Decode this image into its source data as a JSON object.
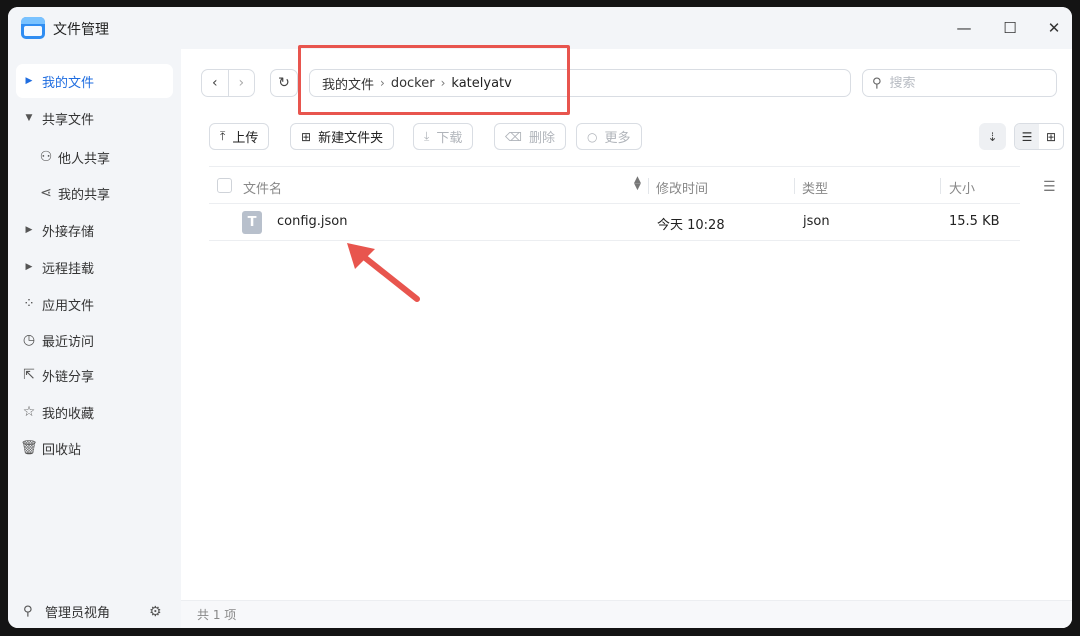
{
  "window": {
    "title": "文件管理",
    "controls": {
      "minimize": "—",
      "maximize": "☐",
      "close": "✕"
    }
  },
  "sidebar": {
    "items": [
      {
        "label": "我的文件",
        "icon": "chevron-right-icon",
        "glyph": "▶",
        "active": true
      },
      {
        "label": "共享文件",
        "icon": "chevron-down-icon",
        "glyph": "▼",
        "expanded": true
      },
      {
        "label": "他人共享",
        "icon": "users-icon",
        "glyph": "⚇"
      },
      {
        "label": "我的共享",
        "icon": "share-icon",
        "glyph": "⋖"
      },
      {
        "label": "外接存储",
        "icon": "chevron-right-icon",
        "glyph": "▶"
      },
      {
        "label": "远程挂载",
        "icon": "chevron-right-icon",
        "glyph": "▶"
      },
      {
        "label": "应用文件",
        "icon": "apps-icon",
        "glyph": "⁘"
      },
      {
        "label": "最近访问",
        "icon": "clock-icon",
        "glyph": "◷"
      },
      {
        "label": "外链分享",
        "icon": "external-link-icon",
        "glyph": "⇱"
      },
      {
        "label": "我的收藏",
        "icon": "star-icon",
        "glyph": "☆"
      },
      {
        "label": "回收站",
        "icon": "trash-icon",
        "glyph": "🗑"
      }
    ],
    "footer": {
      "label": "管理员视角",
      "icon": "user-icon",
      "glyph": "⚲",
      "settings_glyph": "⚙"
    }
  },
  "nav": {
    "back_glyph": "‹",
    "forward_glyph": "›",
    "refresh_glyph": "↻"
  },
  "breadcrumb": {
    "segments": [
      "我的文件",
      "docker",
      "katelyatv"
    ],
    "separator": "›"
  },
  "search": {
    "placeholder": "搜索",
    "value": "",
    "glyph": "⚲"
  },
  "toolbar": {
    "upload": "上传",
    "upload_glyph": "⤒",
    "new_folder": "新建文件夹",
    "new_folder_glyph": "⊞",
    "download": "下载",
    "download_glyph": "⤓",
    "delete": "删除",
    "delete_glyph": "⌫",
    "more": "更多",
    "more_glyph": "○",
    "sort_glyph": "⇣",
    "list_view_glyph": "☰",
    "grid_view_glyph": "⊞"
  },
  "table": {
    "columns": {
      "name": "文件名",
      "modified": "修改时间",
      "type": "类型",
      "size": "大小"
    },
    "sort_glyph": "▲▼",
    "column_menu_glyph": "☰",
    "rows": [
      {
        "name": "config.json",
        "modified": "今天 10:28",
        "type": "json",
        "size": "15.5 KB",
        "icon_glyph": "T"
      }
    ]
  },
  "status": {
    "count": "共 1 项"
  },
  "colors": {
    "accent": "#1f6de0",
    "annotation": "#e8554e"
  }
}
